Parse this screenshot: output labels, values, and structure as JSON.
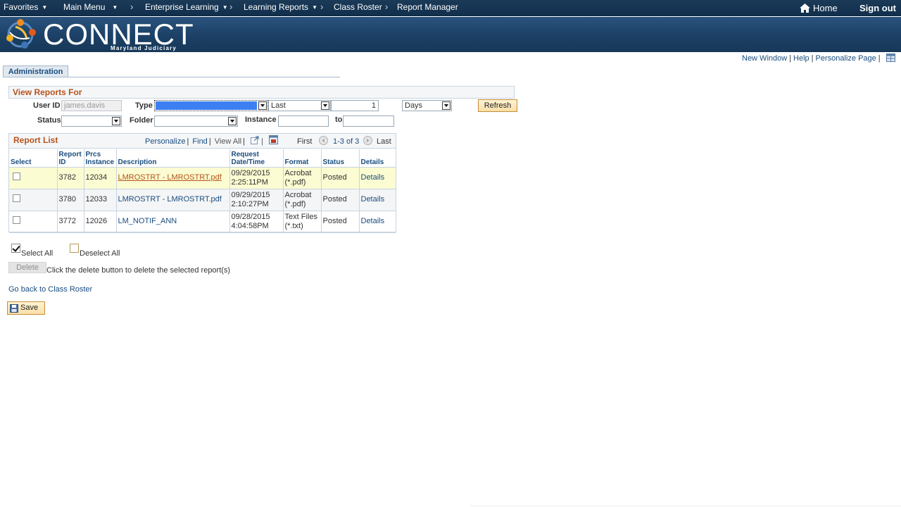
{
  "topnav": {
    "favorites": "Favorites",
    "main_menu": "Main Menu",
    "breadcrumb": [
      "Enterprise Learning",
      "Learning Reports",
      "Class Roster",
      "Report Manager"
    ],
    "home": "Home",
    "sign_out": "Sign out"
  },
  "banner": {
    "logo_text": "CONNECT",
    "logo_sub": "Maryland Judiciary"
  },
  "page_links": {
    "new_window": "New Window",
    "help": "Help",
    "personalize_page": "Personalize Page"
  },
  "tab": {
    "label": "Administration"
  },
  "view_reports": {
    "title": "View Reports For",
    "user_id_label": "User ID",
    "user_id_value": "james.davis",
    "type_label": "Type",
    "type_value": "",
    "last_value": "Last",
    "count_value": "1",
    "unit_value": "Days",
    "refresh": "Refresh",
    "status_label": "Status",
    "status_value": "",
    "folder_label": "Folder",
    "folder_value": "",
    "instance_label": "Instance",
    "instance_from": "",
    "to_label": "to",
    "instance_to": ""
  },
  "report_list": {
    "title": "Report List",
    "personalize": "Personalize",
    "find": "Find",
    "view_all": "View All",
    "first": "First",
    "range": "1-3 of 3",
    "last": "Last",
    "headers": {
      "select": "Select",
      "report_id": "Report ID",
      "prcs_instance": "Prcs Instance",
      "description": "Description",
      "request": "Request Date/Time",
      "format": "Format",
      "status": "Status",
      "details": "Details"
    },
    "rows": [
      {
        "report_id": "3782",
        "prcs_instance": "12034",
        "description": "LMROSTRT - LMROSTRT.pdf",
        "date": "09/29/2015",
        "time": "2:25:11PM",
        "format_1": "Acrobat",
        "format_2": "(*.pdf)",
        "status": "Posted",
        "details": "Details"
      },
      {
        "report_id": "3780",
        "prcs_instance": "12033",
        "description": "LMROSTRT - LMROSTRT.pdf",
        "date": "09/29/2015",
        "time": "2:10:27PM",
        "format_1": "Acrobat",
        "format_2": "(*.pdf)",
        "status": "Posted",
        "details": "Details"
      },
      {
        "report_id": "3772",
        "prcs_instance": "12026",
        "description": "LM_NOTIF_ANN",
        "date": "09/28/2015",
        "time": "4:04:58PM",
        "format_1": "Text Files",
        "format_2": "(*.txt)",
        "status": "Posted",
        "details": "Details"
      }
    ]
  },
  "actions": {
    "select_all": "Select All",
    "deselect_all": "Deselect All",
    "delete": "Delete",
    "delete_hint": "Click the delete button to delete the selected report(s)",
    "go_back": "Go back to Class Roster",
    "save": "Save"
  },
  "colors": {
    "section_title": "#b5531b",
    "link": "#1a4d7f",
    "highlight_row": "#fbfcd2",
    "banner": "#1c4066"
  }
}
